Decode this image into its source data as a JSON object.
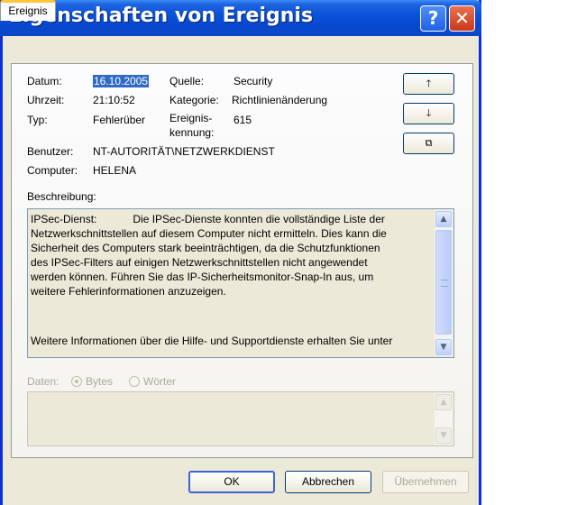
{
  "window": {
    "title": "Eigenschaften von Ereignis",
    "help_glyph": "?",
    "close_glyph": "✕"
  },
  "tabs": [
    {
      "label": "Ereignis",
      "active": true
    }
  ],
  "event": {
    "date_label": "Datum:",
    "date_value": "16.10.2005",
    "time_label": "Uhrzeit:",
    "time_value": "21:10:52",
    "type_label": "Typ:",
    "type_value": "Fehlerüber",
    "user_label": "Benutzer:",
    "user_value": "NT-AUTORITÄT\\NETZWERKDIENST",
    "computer_label": "Computer:",
    "computer_value": "HELENA",
    "source_label": "Quelle:",
    "source_value": "Security",
    "category_label": "Kategorie:",
    "category_value": "Richtlinienänderung",
    "id_label_line1": "Ereignis-",
    "id_label_line2": "kennung:",
    "id_value": "615"
  },
  "nav_buttons": {
    "up": "🡑",
    "down": "🡓",
    "copy": "⧉"
  },
  "description": {
    "label": "Beschreibung:",
    "lines": [
      "IPSec-Dienst:            Die IPSec-Dienste konnten die vollständige Liste der",
      "Netzwerkschnittstellen auf diesem Computer nicht ermitteln. Dies kann die",
      "Sicherheit des Computers stark beeinträchtigen, da die Schutzfunktionen",
      "des IPSec-Filters auf einigen Netzwerkschnittstellen nicht angewendet",
      "werden können. Führen Sie das IP-Sicherheitsmonitor-Snap-In aus, um",
      "weitere Fehlerinformationen anzuzeigen."
    ],
    "footer_line": "Weitere Informationen über die Hilfe- und Supportdienste erhalten Sie unter"
  },
  "data_section": {
    "label": "Daten:",
    "option_bytes": "Bytes",
    "option_words": "Wörter",
    "selected": "Bytes"
  },
  "buttons": {
    "ok": "OK",
    "cancel": "Abbrechen",
    "apply": "Übernehmen"
  },
  "colors": {
    "titlebar": "#0a53d8",
    "selection": "#316ac5",
    "tab_highlight": "#ffc83c"
  }
}
